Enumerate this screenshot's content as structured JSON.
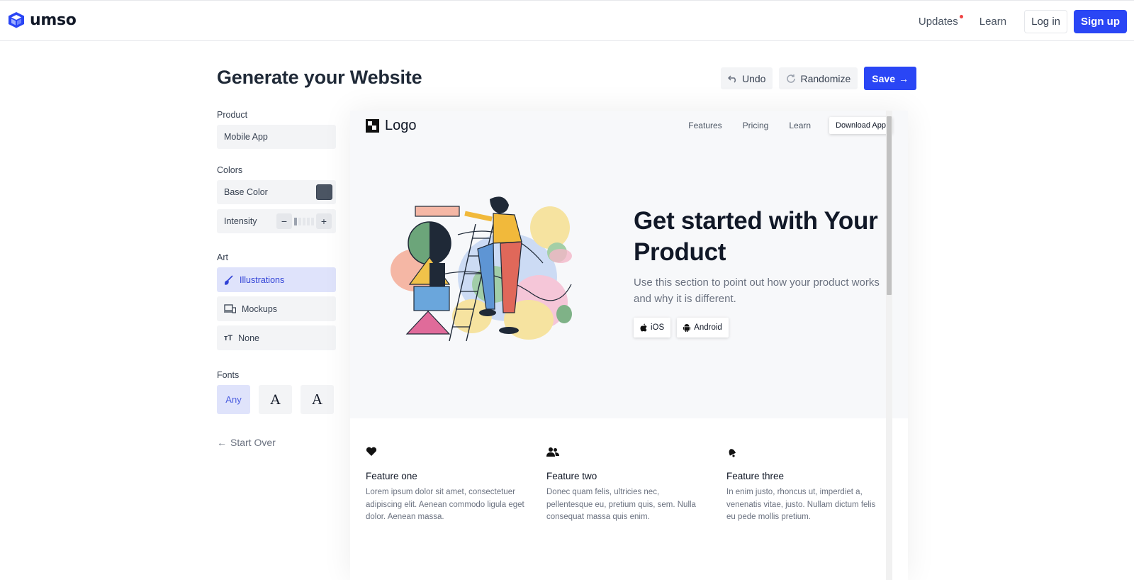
{
  "header": {
    "brand": "umso",
    "nav": [
      "Updates",
      "Learn"
    ],
    "login_label": "Log in",
    "signup_label": "Sign up",
    "accent": "#2a46f5"
  },
  "page": {
    "title": "Generate your Website",
    "undo_label": "Undo",
    "randomize_label": "Randomize",
    "save_label": "Save"
  },
  "sidebar": {
    "product_label": "Product",
    "product_value": "Mobile App",
    "colors_label": "Colors",
    "base_color_label": "Base Color",
    "base_color": "#4b5563",
    "intensity_label": "Intensity",
    "intensity_level": 1,
    "intensity_max": 5,
    "minus": "−",
    "plus": "+",
    "art_label": "Art",
    "art_options": [
      "Illustrations",
      "Mockups",
      "None"
    ],
    "art_selected": "Illustrations",
    "fonts_label": "Fonts",
    "font_options": [
      "Any",
      "A",
      "A"
    ],
    "start_over_label": "Start Over"
  },
  "preview": {
    "logo_text": "Logo",
    "nav": [
      "Features",
      "Pricing",
      "Learn"
    ],
    "download_label": "Download App",
    "headline": "Get started with Your Product",
    "subtext": "Use this section to point out how your product works and why it is different.",
    "buttons": [
      "iOS",
      "Android"
    ],
    "features": [
      {
        "icon": "heart-icon",
        "title": "Feature one",
        "text": "Lorem ipsum dolor sit amet, consectetuer adipiscing elit. Aenean commodo ligula eget dolor. Aenean massa."
      },
      {
        "icon": "users-icon",
        "title": "Feature two",
        "text": "Donec quam felis, ultricies nec, pellentesque eu, pretium quis, sem. Nulla consequat massa quis enim."
      },
      {
        "icon": "bell-icon",
        "title": "Feature three",
        "text": "In enim justo, rhoncus ut, imperdiet a, venenatis vitae, justo. Nullam dictum felis eu pede mollis pretium."
      }
    ]
  }
}
